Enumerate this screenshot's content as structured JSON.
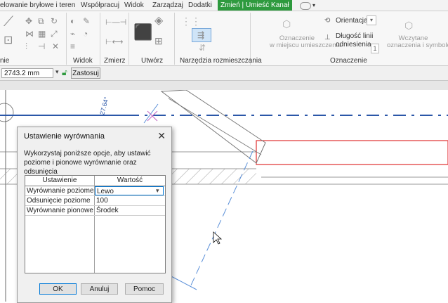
{
  "ribbon": {
    "tabs": [
      "elowanie bryłowe i teren",
      "Współpracuj",
      "Widok",
      "Zarządzaj",
      "Dodatki",
      "Zmień | Umieść Kanał"
    ],
    "active_tab": "Zmień | Umieść Kanał",
    "group_labels": [
      "nie",
      "Widok",
      "Zmierz",
      "Utwórz",
      "Narzędzia rozmieszczania",
      "Oznaczenie"
    ],
    "tag_on_placement": "Oznaczenie\nw miejscu umieszczenia",
    "orientation_label": "Orientacja",
    "leader_length_label": "Długość linii\nodniesienia",
    "leader_value": "1",
    "loaded_tags": "Wczytane\noznaczenia i symbole"
  },
  "options_bar": {
    "dimension_value": "2743.2 mm",
    "apply_label": "Zastosuj"
  },
  "canvas": {
    "angle_annotation": "27.64°"
  },
  "dialog": {
    "title": "Ustawienie wyrównania",
    "description": "Wykorzystaj poniższe opcje, aby ustawić poziome i pionowe wyrównanie oraz odsunięcia",
    "columns": [
      "Ustawienie",
      "Wartość"
    ],
    "rows": [
      {
        "setting": "Wyrównanie poziome",
        "value": "Lewo"
      },
      {
        "setting": "Odsunięcie poziome",
        "value": "100"
      },
      {
        "setting": "Wyrównanie pionowe",
        "value": "Środek"
      }
    ],
    "ok_label": "OK",
    "cancel_label": "Anuluj",
    "help_label": "Pomoc"
  },
  "colors": {
    "active_tab": "#2e9a3e",
    "axis_line": "#2b57a8",
    "duct_outline": "#e03030"
  }
}
